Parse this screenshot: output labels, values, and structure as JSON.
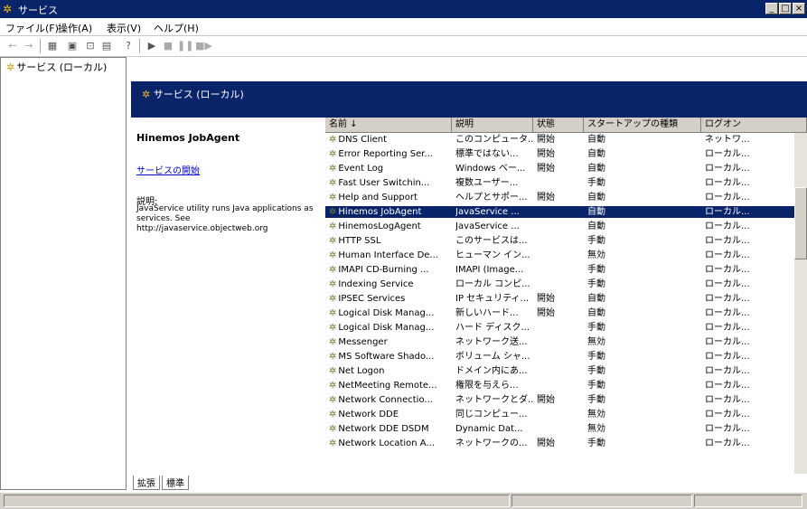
{
  "window": {
    "title": "サービス",
    "buttons": [
      "_",
      "□",
      "×"
    ]
  },
  "menu": [
    "ファイル(F)",
    "操作(A)",
    "表示(V)",
    "ヘルプ(H)"
  ],
  "tree": {
    "root_label": "サービス (ローカル)"
  },
  "banner": {
    "title": "サービス (ローカル)"
  },
  "detail": {
    "service_name": "Hinemos JobAgent",
    "start_link": "サービスの開始",
    "desc_label": "説明:",
    "desc_text": "JavaService utility runs Java applications as services. See http://javaservice.objectweb.org"
  },
  "table": {
    "headers": [
      "名前",
      "説明",
      "状態",
      "スタートアップの種類",
      "ログオン"
    ],
    "rows": [
      {
        "name": "DNS Client",
        "desc": "このコンピュータ...",
        "status": "開始",
        "startup": "自動",
        "logon": "ネットワ..."
      },
      {
        "name": "Error Reporting Ser...",
        "desc": "標準ではない...",
        "status": "開始",
        "startup": "自動",
        "logon": "ローカル..."
      },
      {
        "name": "Event Log",
        "desc": "Windows ベー...",
        "status": "開始",
        "startup": "自動",
        "logon": "ローカル..."
      },
      {
        "name": "Fast User Switchin...",
        "desc": "複数ユーザー...",
        "status": "",
        "startup": "手動",
        "logon": "ローカル..."
      },
      {
        "name": "Help and Support",
        "desc": "ヘルプとサポー...",
        "status": "開始",
        "startup": "自動",
        "logon": "ローカル..."
      },
      {
        "name": "Hinemos JobAgent",
        "desc": "JavaService ...",
        "status": "",
        "startup": "自動",
        "logon": "ローカル...",
        "selected": true
      },
      {
        "name": "HinemosLogAgent",
        "desc": "JavaService ...",
        "status": "",
        "startup": "自動",
        "logon": "ローカル..."
      },
      {
        "name": "HTTP SSL",
        "desc": "このサービスは...",
        "status": "",
        "startup": "手動",
        "logon": "ローカル..."
      },
      {
        "name": "Human Interface De...",
        "desc": "ヒューマン イン...",
        "status": "",
        "startup": "無効",
        "logon": "ローカル..."
      },
      {
        "name": "IMAPI CD-Burning ...",
        "desc": "IMAPI (Image...",
        "status": "",
        "startup": "手動",
        "logon": "ローカル..."
      },
      {
        "name": "Indexing Service",
        "desc": "ローカル コンピ...",
        "status": "",
        "startup": "手動",
        "logon": "ローカル..."
      },
      {
        "name": "IPSEC Services",
        "desc": "IP セキュリティ...",
        "status": "開始",
        "startup": "自動",
        "logon": "ローカル..."
      },
      {
        "name": "Logical Disk Manag...",
        "desc": "新しいハード...",
        "status": "開始",
        "startup": "自動",
        "logon": "ローカル..."
      },
      {
        "name": "Logical Disk Manag...",
        "desc": "ハード ディスク...",
        "status": "",
        "startup": "手動",
        "logon": "ローカル..."
      },
      {
        "name": "Messenger",
        "desc": "ネットワーク送...",
        "status": "",
        "startup": "無効",
        "logon": "ローカル..."
      },
      {
        "name": "MS Software Shado...",
        "desc": "ボリューム シャ...",
        "status": "",
        "startup": "手動",
        "logon": "ローカル..."
      },
      {
        "name": "Net Logon",
        "desc": "ドメイン内にあ...",
        "status": "",
        "startup": "手動",
        "logon": "ローカル..."
      },
      {
        "name": "NetMeeting Remote...",
        "desc": "権限を与えら...",
        "status": "",
        "startup": "手動",
        "logon": "ローカル..."
      },
      {
        "name": "Network Connectio...",
        "desc": "ネットワークとダ...",
        "status": "開始",
        "startup": "手動",
        "logon": "ローカル..."
      },
      {
        "name": "Network DDE",
        "desc": "同じコンピュー...",
        "status": "",
        "startup": "無効",
        "logon": "ローカル..."
      },
      {
        "name": "Network DDE DSDM",
        "desc": "Dynamic Dat...",
        "status": "",
        "startup": "無効",
        "logon": "ローカル..."
      },
      {
        "name": "Network Location A...",
        "desc": "ネットワークの...",
        "status": "開始",
        "startup": "手動",
        "logon": "ローカル..."
      }
    ]
  },
  "tabs": [
    "拡張",
    "標準"
  ]
}
